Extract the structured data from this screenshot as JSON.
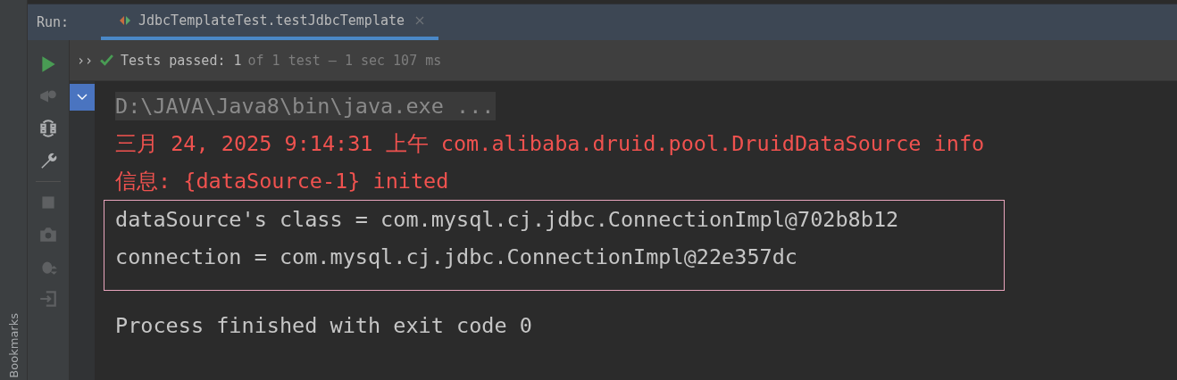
{
  "run_bar": {
    "label": "Run:",
    "tab": {
      "title": "JdbcTemplateTest.testJdbcTemplate",
      "selected": true
    }
  },
  "status": {
    "chevron": "››",
    "passed": "Tests passed: 1",
    "rest": "of 1 test – 1 sec 107 ms"
  },
  "toolbar": [
    {
      "kind": "play",
      "disabled": false
    },
    {
      "kind": "rerun",
      "disabled": true
    },
    {
      "kind": "toggle",
      "disabled": false
    },
    {
      "kind": "wrench",
      "disabled": false
    },
    {
      "kind": "divider"
    },
    {
      "kind": "stop",
      "disabled": true
    },
    {
      "kind": "camera",
      "disabled": true
    },
    {
      "kind": "bug",
      "disabled": true
    },
    {
      "kind": "exit",
      "disabled": true
    }
  ],
  "side_label": "Bookmarks",
  "console": {
    "lines_before": [
      {
        "kind": "cmd",
        "text": "D:\\JAVA\\Java8\\bin\\java.exe ..."
      },
      {
        "kind": "err",
        "text": "三月 24, 2025 9:14:31 上午 com.alibaba.druid.pool.DruidDataSource info"
      },
      {
        "kind": "err",
        "text": "信息: {dataSource-1} inited"
      }
    ],
    "boxed_lines": [
      {
        "kind": "out",
        "text": "dataSource's class = com.mysql.cj.jdbc.ConnectionImpl@702b8b12"
      },
      {
        "kind": "out",
        "text": "connection = com.mysql.cj.jdbc.ConnectionImpl@22e357dc"
      }
    ],
    "lines_after": [
      {
        "kind": "out",
        "text": "Process finished with exit code 0"
      }
    ]
  }
}
